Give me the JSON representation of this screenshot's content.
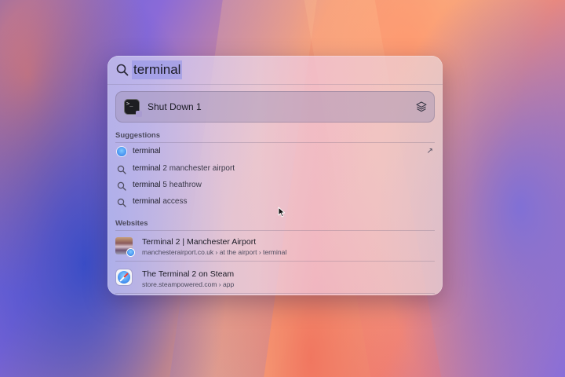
{
  "search": {
    "query": "terminal"
  },
  "top_hit": {
    "label": "Shut Down 1",
    "icon": "terminal-icon",
    "action_icon": "layers-icon"
  },
  "suggestions": {
    "title": "Suggestions",
    "items": [
      {
        "bold": "terminal",
        "rest": "",
        "icon": "safari-icon",
        "trailing_icon": "arrow-up-right-icon"
      },
      {
        "bold": "terminal",
        "rest": " 2 manchester airport",
        "icon": "search-icon"
      },
      {
        "bold": "terminal",
        "rest": " 5 heathrow",
        "icon": "search-icon"
      },
      {
        "bold": "terminal",
        "rest": " access",
        "icon": "search-icon"
      }
    ]
  },
  "websites": {
    "title": "Websites",
    "items": [
      {
        "title": "Terminal 2 | Manchester Airport",
        "url": "manchesterairport.co.uk › at the airport › terminal",
        "icon": "webpage-thumbnail"
      },
      {
        "title": "The Terminal 2 on Steam",
        "url": "store.steampowered.com › app",
        "icon": "safari-icon"
      }
    ]
  },
  "colors": {
    "selection": "#9696e6",
    "text": "#1b1b25",
    "muted": "#4d4b5e"
  }
}
